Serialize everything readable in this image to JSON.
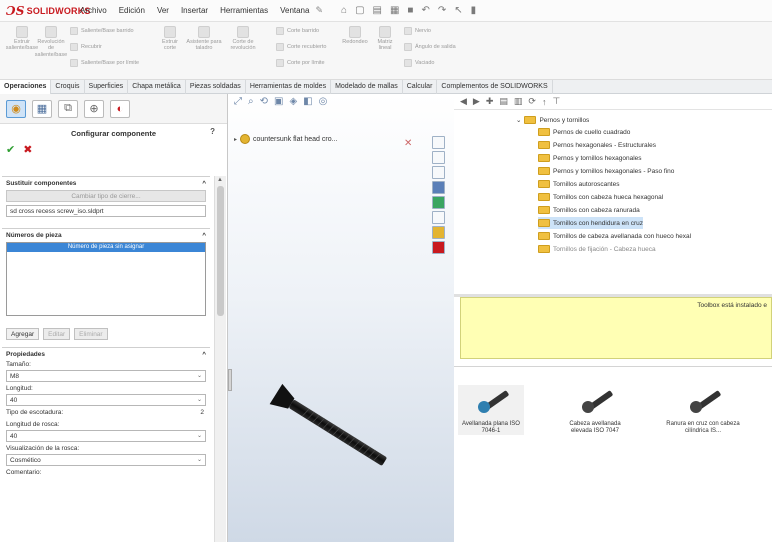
{
  "app": {
    "logo_text": "SOLIDWORKS",
    "menu": [
      "Archivo",
      "Edición",
      "Ver",
      "Insertar",
      "Herramientas",
      "Ventana"
    ]
  },
  "ribbon": {
    "items": [
      "Extruir saliente/base",
      "Revolución de saliente/base",
      "Saliente/Base barrido",
      "Recubrir",
      "Saliente/Base por límite",
      "Extruir corte",
      "Asistente para taladro",
      "Corte de revolución",
      "Corte barrido",
      "Corte recubierto",
      "Corte por límite",
      "Redondeo",
      "Matriz lineal",
      "Nervio",
      "Ángulo de salida",
      "Vaciado"
    ]
  },
  "tabs": [
    "Operaciones",
    "Croquis",
    "Superficies",
    "Chapa metálica",
    "Piezas soldadas",
    "Herramientas de moldes",
    "Modelado de mallas",
    "Calcular",
    "Complementos de SOLIDWORKS"
  ],
  "property_manager": {
    "title": "Configurar componente",
    "help": "?",
    "sustituir": {
      "header": "Sustituir componentes",
      "button": "Cambiar tipo de cierre...",
      "value": "sd cross recess screw_iso.sldprt"
    },
    "numeros": {
      "header": "Números de pieza",
      "selected": "Número de pieza sin asignar",
      "buttons": [
        "Agregar",
        "Editar",
        "Eliminar"
      ]
    },
    "propiedades": {
      "header": "Propiedades",
      "tamano_label": "Tamaño:",
      "tamano_value": "M8",
      "longitud_label": "Longitud:",
      "longitud_value": "40",
      "tipo_label": "Tipo de escotadura:",
      "tipo_value": "2",
      "rosca_label": "Longitud de rosca:",
      "rosca_value": "40",
      "vis_label": "Visualización de la rosca:",
      "vis_value": "Cosmético",
      "comentario_label": "Comentario:"
    }
  },
  "graphics": {
    "tree_item": "countersunk flat head cro..."
  },
  "toolbox": {
    "root": "Pernos y tornillos",
    "items": [
      "Pernos de cuello cuadrado",
      "Pernos hexagonales - Estructurales",
      "Pernos y tornillos hexagonales",
      "Pernos y tornillos hexagonales - Paso fino",
      "Tornillos autoroscantes",
      "Tornillos con cabeza hueca hexagonal",
      "Tornillos con cabeza ranurada",
      "Tornillos con hendidura en cruz",
      "Tornillos de cabeza avellanada con hueco hexal",
      "Tornillos de fijación - Cabeza hueca"
    ],
    "selected_index": 7,
    "notice": "Toolbox está instalado e",
    "results": [
      "Avellanada plana ISO 7046-1",
      "Cabeza avellanada elevada ISO 7047",
      "Ranura en cruz con cabeza cilíndrica IS..."
    ]
  }
}
